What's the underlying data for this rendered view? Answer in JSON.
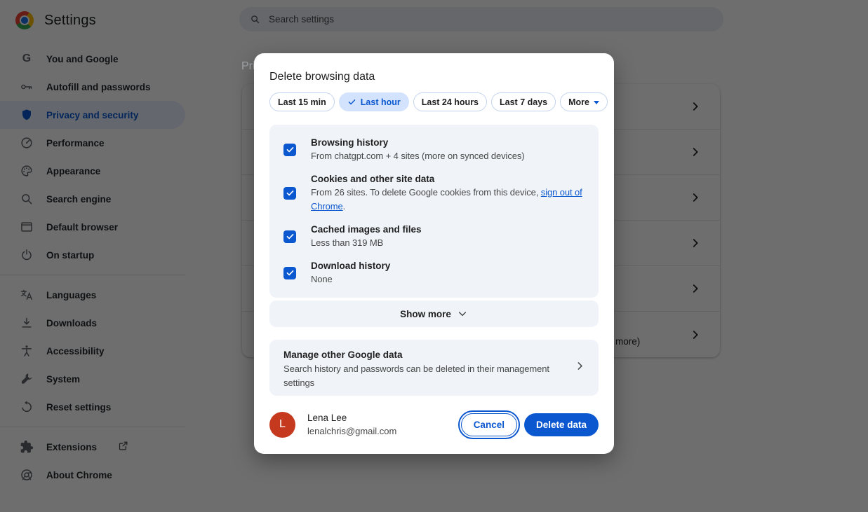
{
  "app": {
    "title": "Settings",
    "search_placeholder": "Search settings"
  },
  "sidebar": {
    "primary": [
      {
        "label": "You and Google",
        "icon": "google-g-icon",
        "selected": false
      },
      {
        "label": "Autofill and passwords",
        "icon": "key-icon",
        "selected": false
      },
      {
        "label": "Privacy and security",
        "icon": "shield-icon",
        "selected": true
      },
      {
        "label": "Performance",
        "icon": "speedometer-icon",
        "selected": false
      },
      {
        "label": "Appearance",
        "icon": "palette-icon",
        "selected": false
      },
      {
        "label": "Search engine",
        "icon": "magnifier-icon",
        "selected": false
      },
      {
        "label": "Default browser",
        "icon": "browser-window-icon",
        "selected": false
      },
      {
        "label": "On startup",
        "icon": "power-icon",
        "selected": false
      }
    ],
    "secondary": [
      {
        "label": "Languages",
        "icon": "translate-icon"
      },
      {
        "label": "Downloads",
        "icon": "download-icon"
      },
      {
        "label": "Accessibility",
        "icon": "accessibility-icon"
      },
      {
        "label": "System",
        "icon": "wrench-icon"
      },
      {
        "label": "Reset settings",
        "icon": "reset-icon"
      }
    ],
    "footer": [
      {
        "label": "Extensions",
        "icon": "puzzle-icon",
        "external": true
      },
      {
        "label": "About Chrome",
        "icon": "chrome-icon"
      }
    ]
  },
  "page_behind": {
    "heading_fragment": "Pri",
    "visible_row_fragment": "more)",
    "row_count": 6
  },
  "dialog": {
    "title": "Delete browsing data",
    "time_chips": [
      {
        "label": "Last 15 min",
        "selected": false
      },
      {
        "label": "Last hour",
        "selected": true
      },
      {
        "label": "Last 24 hours",
        "selected": false
      },
      {
        "label": "Last 7 days",
        "selected": false
      },
      {
        "label": "More",
        "selected": false,
        "dropdown": true
      }
    ],
    "checkboxes": [
      {
        "label": "Browsing history",
        "description": "From chatgpt.com + 4 sites (more on synced devices)",
        "checked": true
      },
      {
        "label": "Cookies and other site data",
        "description_prefix": "From 26 sites. To delete Google cookies from this device, ",
        "link_text": "sign out of Chrome",
        "description_suffix": ".",
        "checked": true
      },
      {
        "label": "Cached images and files",
        "description": "Less than 319 MB",
        "checked": true
      },
      {
        "label": "Download history",
        "description": "None",
        "checked": true
      }
    ],
    "show_more_label": "Show more",
    "manage": {
      "title": "Manage other Google data",
      "description": "Search history and passwords can be deleted in their management settings"
    },
    "footer": {
      "avatar_letter": "L",
      "name": "Lena Lee",
      "email": "lenalchris@gmail.com",
      "cancel_label": "Cancel",
      "confirm_label": "Delete data"
    },
    "colors": {
      "accent_blue": "#0b57d0",
      "selected_chip_bg": "#d3e3fd",
      "section_bg": "#f0f4f9",
      "avatar_bg": "#c5391e",
      "scrim": "rgba(0,0,0,0.57)"
    }
  }
}
